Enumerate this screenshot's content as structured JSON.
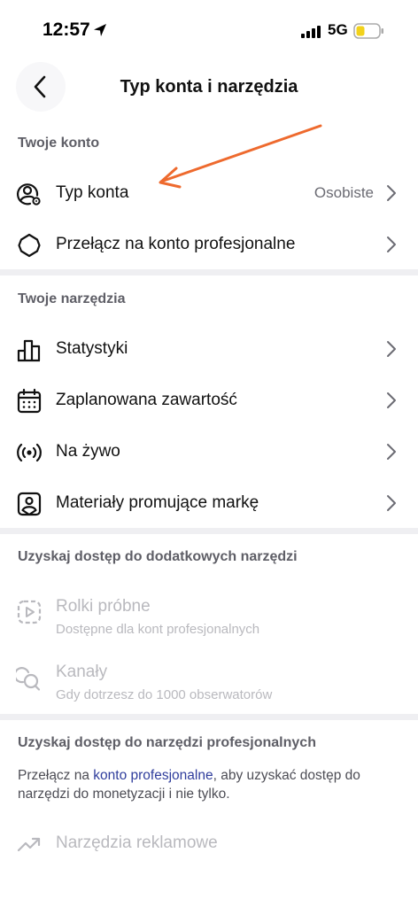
{
  "status_bar": {
    "time": "12:57",
    "network": "5G"
  },
  "header": {
    "title": "Typ konta i narzędzia"
  },
  "sections": {
    "account": {
      "title": "Twoje konto",
      "account_type": {
        "label": "Typ konta",
        "value": "Osobiste"
      },
      "switch_pro": {
        "label": "Przełącz na konto profesjonalne"
      }
    },
    "tools": {
      "title": "Twoje narzędzia",
      "stats": {
        "label": "Statystyki"
      },
      "scheduled": {
        "label": "Zaplanowana zawartość"
      },
      "live": {
        "label": "Na żywo"
      },
      "brand": {
        "label": "Materiały promujące markę"
      }
    },
    "extra": {
      "title": "Uzyskaj dostęp do dodatkowych narzędzi",
      "trial_reels": {
        "label": "Rolki próbne",
        "sub": "Dostępne dla kont profesjonalnych"
      },
      "channels": {
        "label": "Kanały",
        "sub": "Gdy dotrzesz do 1000 obserwatorów"
      }
    },
    "pro": {
      "title": "Uzyskaj dostęp do narzędzi profesjonalnych",
      "info_before": "Przełącz na ",
      "info_link": "konto profesjonalne",
      "info_after": ", aby uzyskać dostęp do narzędzi do monetyzacji i nie tylko.",
      "ad_tools": {
        "label": "Narzędzia reklamowe"
      }
    }
  },
  "colors": {
    "annotation_arrow": "#ee6a2e",
    "link": "#2f3d9c",
    "divider": "#efeff2",
    "disabled_text": "#b9b9be"
  },
  "icons": {
    "back": "chevron-left-icon",
    "account_type": "user-circle-gear-icon",
    "switch_pro": "gear-icon",
    "stats": "bar-chart-icon",
    "scheduled": "calendar-icon",
    "live": "live-broadcast-icon",
    "brand": "brand-content-icon",
    "trial_reels": "reels-play-icon",
    "channels": "chat-bubbles-icon",
    "ad_tools": "trending-up-icon"
  }
}
